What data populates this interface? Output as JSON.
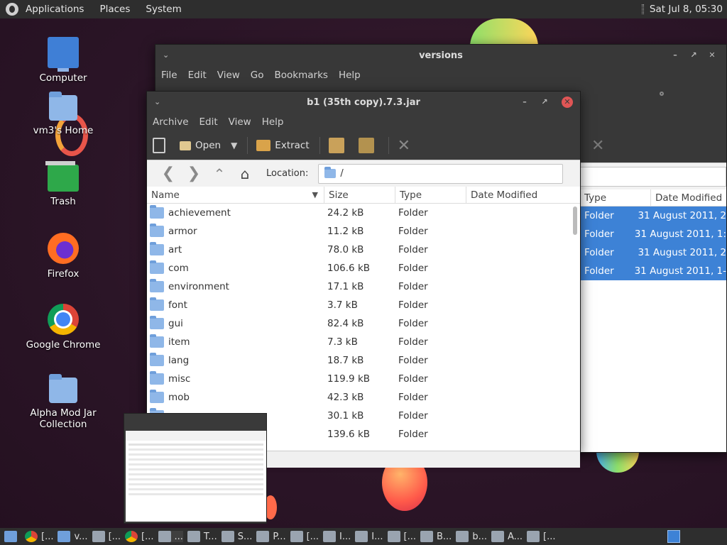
{
  "top_panel": {
    "applications": "Applications",
    "places": "Places",
    "system": "System",
    "clock": "Sat Jul  8, 05:30"
  },
  "desktop_icons": [
    {
      "label": "Computer"
    },
    {
      "label": "vm3's Home"
    },
    {
      "label": "Trash"
    },
    {
      "label": "Firefox"
    },
    {
      "label": "Google Chrome"
    },
    {
      "label": "Alpha Mod Jar Collection"
    }
  ],
  "back_window": {
    "title": "versions",
    "menu": [
      "File",
      "Edit",
      "View",
      "Go",
      "Bookmarks",
      "Help"
    ],
    "columns": {
      "type": "Type",
      "date": "Date Modified"
    },
    "rows": [
      {
        "type": "Folder",
        "date": "31 August 2011, 2"
      },
      {
        "type": "Folder",
        "date": "31 August 2011, 1:"
      },
      {
        "type": "Folder",
        "date": "31 August 2011, 2"
      },
      {
        "type": "Folder",
        "date": "31 August 2011, 1-"
      }
    ]
  },
  "archive_window": {
    "title": "b1 (35th copy).7.3.jar",
    "menu": [
      "Archive",
      "Edit",
      "View",
      "Help"
    ],
    "toolbar": {
      "open": "Open",
      "extract": "Extract"
    },
    "location_label": "Location:",
    "location_value": "/",
    "columns": {
      "name": "Name",
      "size": "Size",
      "type": "Type",
      "date": "Date Modified"
    },
    "rows": [
      {
        "name": "achievement",
        "size": "24.2 kB",
        "type": "Folder"
      },
      {
        "name": "armor",
        "size": "11.2 kB",
        "type": "Folder"
      },
      {
        "name": "art",
        "size": "78.0 kB",
        "type": "Folder"
      },
      {
        "name": "com",
        "size": "106.6 kB",
        "type": "Folder"
      },
      {
        "name": "environment",
        "size": "17.1 kB",
        "type": "Folder"
      },
      {
        "name": "font",
        "size": "3.7 kB",
        "type": "Folder"
      },
      {
        "name": "gui",
        "size": "82.4 kB",
        "type": "Folder"
      },
      {
        "name": "item",
        "size": "7.3 kB",
        "type": "Folder"
      },
      {
        "name": "lang",
        "size": "18.7 kB",
        "type": "Folder"
      },
      {
        "name": "misc",
        "size": "119.9 kB",
        "type": "Folder"
      },
      {
        "name": "mob",
        "size": "42.3 kB",
        "type": "Folder"
      },
      {
        "name": "",
        "size": "30.1 kB",
        "type": "Folder"
      },
      {
        "name": "",
        "size": "139.6 kB",
        "type": "Folder"
      }
    ]
  },
  "taskbar": {
    "items": [
      "[...",
      "v...",
      "[...",
      "[...",
      "...",
      "T...",
      "S...",
      "P...",
      "[...",
      "I...",
      "I...",
      "[...",
      "B...",
      "b...",
      "A...",
      "[..."
    ]
  },
  "colors": {
    "selection": "#3d82d6",
    "panel": "#2e2e2e",
    "close_button": "#e05555"
  }
}
